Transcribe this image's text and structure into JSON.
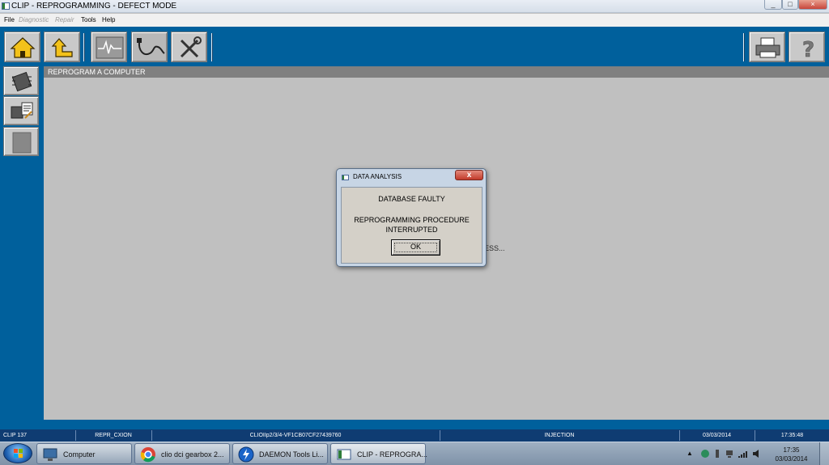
{
  "window": {
    "title": "CLIP - REPROGRAMMING - DEFECT MODE",
    "controls": [
      "_",
      "□",
      "×"
    ]
  },
  "menu": [
    {
      "label": "File",
      "enabled": true
    },
    {
      "label": "Diagnostic",
      "enabled": false
    },
    {
      "label": "Repair",
      "enabled": false
    },
    {
      "label": "Tools",
      "enabled": true
    },
    {
      "label": "Help",
      "enabled": true
    }
  ],
  "toolbar": {
    "buttons": [
      "home-icon",
      "back-icon",
      "oscilloscope-icon",
      "probe-cable-icon",
      "tools-icon"
    ],
    "right_buttons": [
      "printer-icon",
      "help-icon"
    ]
  },
  "sidebar": {
    "buttons": [
      "ecu-chip-icon",
      "reprogram-chip-icon",
      "blank-chip-icon"
    ]
  },
  "panel": {
    "title": "REPROGRAM A COMPUTER",
    "background_text": "ESS..."
  },
  "dialog": {
    "title": "DATA ANALYSIS",
    "close_label": "x",
    "line1": "DATABASE FAULTY",
    "line2": "REPROGRAMMING PROCEDURE",
    "line3": "INTERRUPTED",
    "ok_label": "OK"
  },
  "statusbar": {
    "cells": [
      "CLIP 137",
      "REPR_CXION",
      "CLIOIIp2/3/4-VF1CB07CF27439760",
      "INJECTION",
      "03/03/2014",
      "17:35:48"
    ]
  },
  "taskbar": {
    "items": [
      {
        "label": "Computer",
        "icon": "computer-icon"
      },
      {
        "label": "clio dci gearbox 2...",
        "icon": "chrome-icon"
      },
      {
        "label": "DAEMON Tools Li...",
        "icon": "daemon-tools-icon"
      },
      {
        "label": "CLIP - REPROGRA...",
        "icon": "clip-app-icon"
      }
    ],
    "clock_time": "17:35",
    "clock_date": "03/03/2014"
  },
  "colors": {
    "app_blue": "#00609c",
    "status_blue": "#0f3c72",
    "panel_gray": "#c0c0c0"
  }
}
